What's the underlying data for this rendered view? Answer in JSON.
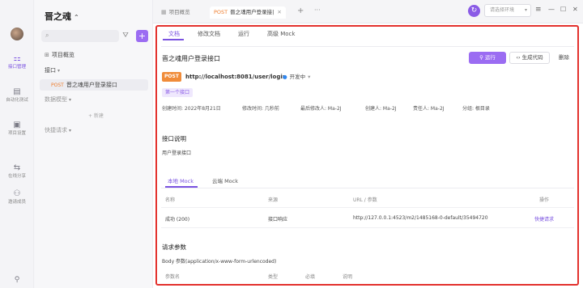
{
  "rail": {
    "items": [
      {
        "label": "接口管理",
        "icon": "api-icon",
        "glyph": "⚏"
      },
      {
        "label": "自动化测试",
        "icon": "test-icon",
        "glyph": "▤"
      },
      {
        "label": "项目设置",
        "icon": "settings-icon",
        "glyph": "▣"
      },
      {
        "label": "在线分享",
        "icon": "share-icon",
        "glyph": "⇆"
      },
      {
        "label": "邀请成员",
        "icon": "invite-icon",
        "glyph": "⚇"
      }
    ],
    "bottom_glyph": "⚲"
  },
  "sidebar": {
    "project_name": "晋之魂",
    "project_chevron": "⌃",
    "search_glyph": "⌕",
    "filter_glyph": "⛛",
    "add_glyph": "+",
    "overview_glyph": "⊞",
    "overview": "项目概览",
    "folder_api": "接口",
    "folder_api_caret": "▾",
    "api_method": "POST",
    "api_name": "晋之魂用户登录接口",
    "folder_models": "数据模型",
    "folder_models_caret": "▾",
    "new_label": "+ 新建",
    "folder_quick": "快捷请求",
    "folder_quick_caret": "▾"
  },
  "tabs": {
    "tab1_icon": "▦",
    "tab1_label": "项目概览",
    "tab2_method": "POST",
    "tab2_label": "晋之魂用户登录接|",
    "tab2_close": "✕",
    "plus": "+",
    "more": "···",
    "sync_glyph": "↻",
    "env_placeholder": "请选择环境",
    "env_caret": "▾",
    "menu_glyph": "≡",
    "win_min": "—",
    "win_max": "☐",
    "win_close": "✕"
  },
  "main": {
    "subtabs": [
      "文档",
      "修改文档",
      "运行",
      "高级 Mock"
    ],
    "api_title": "晋之魂用户登录接口",
    "run_label": "⚲ 运行",
    "gen_code_label": "‹› 生成代码",
    "delete_label": "删除",
    "method": "POST",
    "url": "http://localhost:8081/user/login",
    "status_dot": "●",
    "status": "开发中",
    "status_caret": "▾",
    "tag": "第一个接口",
    "meta": [
      "创建时间: 2022年8月21日",
      "修改时间: 几秒前",
      "最后修改人: Ma-2J",
      "创建人: Ma-2J",
      "责任人: Ma-2J",
      "分组: 根目录"
    ],
    "desc_title": "接口说明",
    "desc_text": "用户登录接口",
    "mock_tabs": [
      "本地 Mock",
      "云端 Mock"
    ],
    "mock_table": {
      "headers": [
        "名称",
        "来源",
        "URL / 参数",
        "操作"
      ],
      "rows": [
        {
          "name": "成功 (200)",
          "source": "接口响应",
          "url": "http://127.0.0.1:4523/m2/1485168-0-default/35494720",
          "action": "快捷请求"
        }
      ]
    },
    "params_title": "请求参数",
    "body_label": "Body 参数(application/x-www-form-urlencoded)",
    "params_headers": [
      "参数名",
      "类型",
      "必填",
      "说明"
    ]
  },
  "colors": {
    "accent": "#7a52e0",
    "accent_button": "#9b6cf2",
    "post_badge": "#f08c3a",
    "highlight_frame": "#e3312d",
    "status_dot": "#2f87f0"
  }
}
